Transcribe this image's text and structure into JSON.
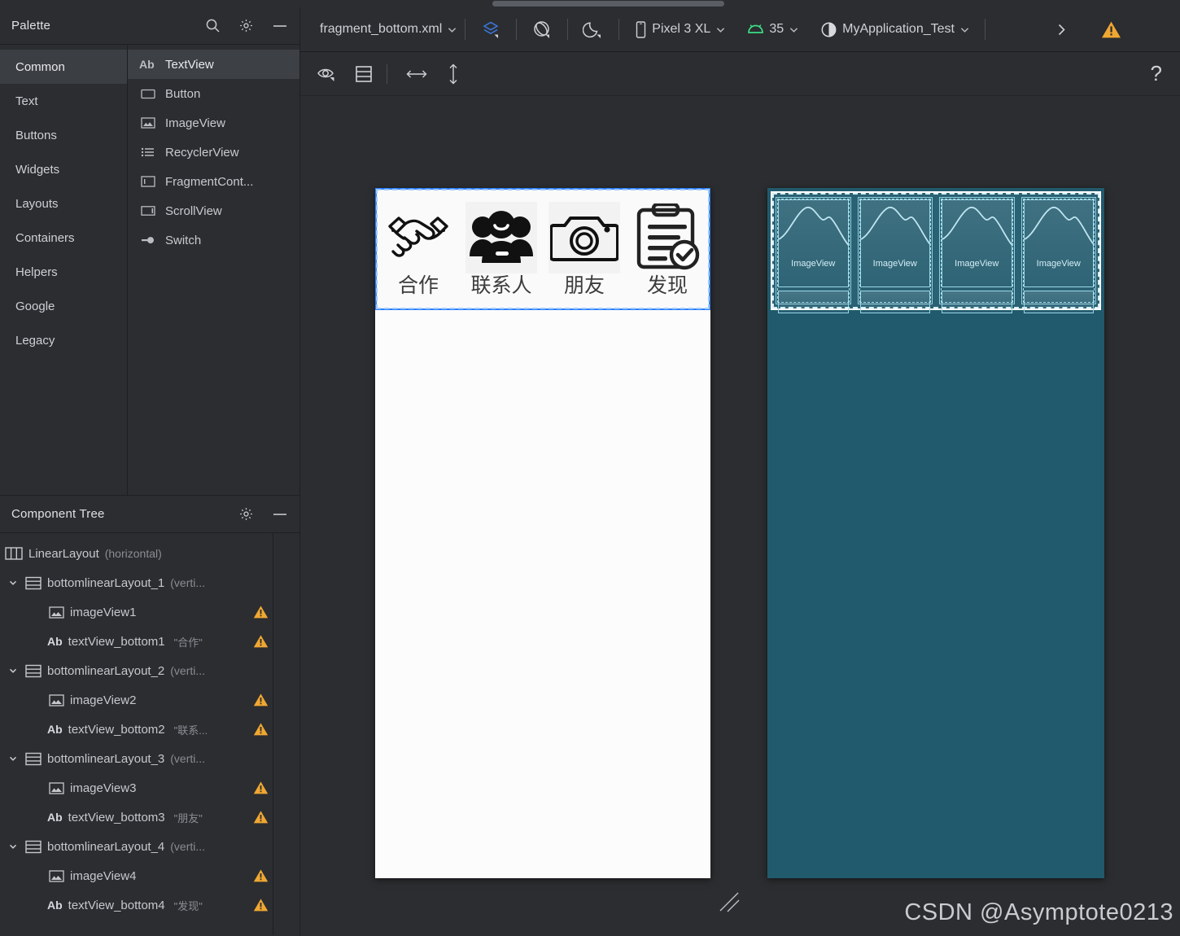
{
  "palette": {
    "title": "Palette",
    "search_icon": "search-icon",
    "settings_icon": "gear-icon",
    "minimize_icon": "minimize-icon",
    "categories": [
      {
        "label": "Common",
        "selected": true
      },
      {
        "label": "Text",
        "selected": false
      },
      {
        "label": "Buttons",
        "selected": false
      },
      {
        "label": "Widgets",
        "selected": false
      },
      {
        "label": "Layouts",
        "selected": false
      },
      {
        "label": "Containers",
        "selected": false
      },
      {
        "label": "Helpers",
        "selected": false
      },
      {
        "label": "Google",
        "selected": false
      },
      {
        "label": "Legacy",
        "selected": false
      }
    ],
    "components": [
      {
        "label": "TextView",
        "icon": "ab-text-icon",
        "selected": true
      },
      {
        "label": "Button",
        "icon": "button-icon",
        "selected": false
      },
      {
        "label": "ImageView",
        "icon": "image-icon",
        "selected": false
      },
      {
        "label": "RecyclerView",
        "icon": "list-icon",
        "selected": false
      },
      {
        "label": "FragmentCont...",
        "icon": "fragment-icon",
        "selected": false
      },
      {
        "label": "ScrollView",
        "icon": "scrollview-icon",
        "selected": false
      },
      {
        "label": "Switch",
        "icon": "switch-icon",
        "selected": false
      }
    ]
  },
  "component_tree": {
    "title": "Component Tree",
    "settings_icon": "gear-icon",
    "minimize_icon": "minimize-icon",
    "rows": [
      {
        "indent": 0,
        "expander": "",
        "icon": "linearlayout-horizontal-icon",
        "name": "LinearLayout",
        "sub": "(horizontal)",
        "value": "",
        "warning": false
      },
      {
        "indent": 1,
        "expander": "chevron-down-icon",
        "icon": "linearlayout-vertical-icon",
        "name": "bottomlinearLayout_1",
        "sub": "(verti...",
        "value": "",
        "warning": false
      },
      {
        "indent": 2,
        "expander": "",
        "icon": "image-icon",
        "name": "imageView1",
        "sub": "",
        "value": "",
        "warning": true
      },
      {
        "indent": 2,
        "expander": "",
        "icon": "ab-text-icon",
        "name": "textView_bottom1",
        "sub": "",
        "value": "\"合作\"",
        "warning": true
      },
      {
        "indent": 1,
        "expander": "chevron-down-icon",
        "icon": "linearlayout-vertical-icon",
        "name": "bottomlinearLayout_2",
        "sub": "(verti...",
        "value": "",
        "warning": false
      },
      {
        "indent": 2,
        "expander": "",
        "icon": "image-icon",
        "name": "imageView2",
        "sub": "",
        "value": "",
        "warning": true
      },
      {
        "indent": 2,
        "expander": "",
        "icon": "ab-text-icon",
        "name": "textView_bottom2",
        "sub": "",
        "value": "\"联系...",
        "warning": true
      },
      {
        "indent": 1,
        "expander": "chevron-down-icon",
        "icon": "linearlayout-vertical-icon",
        "name": "bottomlinearLayout_3",
        "sub": "(verti...",
        "value": "",
        "warning": false
      },
      {
        "indent": 2,
        "expander": "",
        "icon": "image-icon",
        "name": "imageView3",
        "sub": "",
        "value": "",
        "warning": true
      },
      {
        "indent": 2,
        "expander": "",
        "icon": "ab-text-icon",
        "name": "textView_bottom3",
        "sub": "",
        "value": "\"朋友\"",
        "warning": true
      },
      {
        "indent": 1,
        "expander": "chevron-down-icon",
        "icon": "linearlayout-vertical-icon",
        "name": "bottomlinearLayout_4",
        "sub": "(verti...",
        "value": "",
        "warning": false
      },
      {
        "indent": 2,
        "expander": "",
        "icon": "image-icon",
        "name": "imageView4",
        "sub": "",
        "value": "",
        "warning": true
      },
      {
        "indent": 2,
        "expander": "",
        "icon": "ab-text-icon",
        "name": "textView_bottom4",
        "sub": "",
        "value": "\"发现\"",
        "warning": true
      }
    ]
  },
  "toolbar": {
    "file_name": "fragment_bottom.xml",
    "file_chevron": "chevron-down-icon",
    "design_mode_icon": "design-surface-icon",
    "orientation_icon": "rotate-device-icon",
    "theme_icon": "night-mode-icon",
    "device_icon": "phone-icon",
    "device_name": "Pixel 3 XL",
    "device_chevron": "chevron-down-icon",
    "api_icon": "android-icon",
    "api_level": "35",
    "api_chevron": "chevron-down-icon",
    "theme_swatch_icon": "theme-contrast-icon",
    "theme_name": "MyApplication_Test",
    "theme_chevron": "chevron-down-icon",
    "overflow_icon": "chevron-right-icon",
    "warning_icon": "warning-triangle-icon"
  },
  "toolbar2": {
    "view_options_icon": "eye-icon",
    "layout_variants_icon": "layout-rows-icon",
    "pan_horizontal_icon": "arrow-left-right-icon",
    "pan_vertical_icon": "arrow-up-down-icon",
    "help_icon": "question-mark-icon",
    "help_label": "?"
  },
  "canvas": {
    "render_preview": {
      "name": "render-preview",
      "bar_items": [
        {
          "icon": "handshake-icon",
          "label": "合作"
        },
        {
          "icon": "contacts-people-icon",
          "label": "联系人"
        },
        {
          "icon": "camera-icon",
          "label": "朋友"
        },
        {
          "icon": "clipboard-check-icon",
          "label": "发现"
        }
      ]
    },
    "blueprint_preview": {
      "name": "blueprint-preview",
      "bar_items": [
        {
          "label": "ImageView"
        },
        {
          "label": "ImageView"
        },
        {
          "label": "ImageView"
        },
        {
          "label": "ImageView"
        }
      ]
    },
    "resize_handle_icon": "resize-handle-icon"
  },
  "watermark": "CSDN @Asymptote0213",
  "colors": {
    "background": "#2b2d30",
    "panel_border": "#1e1f22",
    "selection_blue": "#2b7fff",
    "blueprint_bg": "#215a6d",
    "blueprint_line": "#9ad6e5",
    "warning_amber": "#f0a732",
    "android_green": "#3ddc84",
    "text_primary": "#cfd1d7",
    "text_muted": "#8a8d93"
  }
}
